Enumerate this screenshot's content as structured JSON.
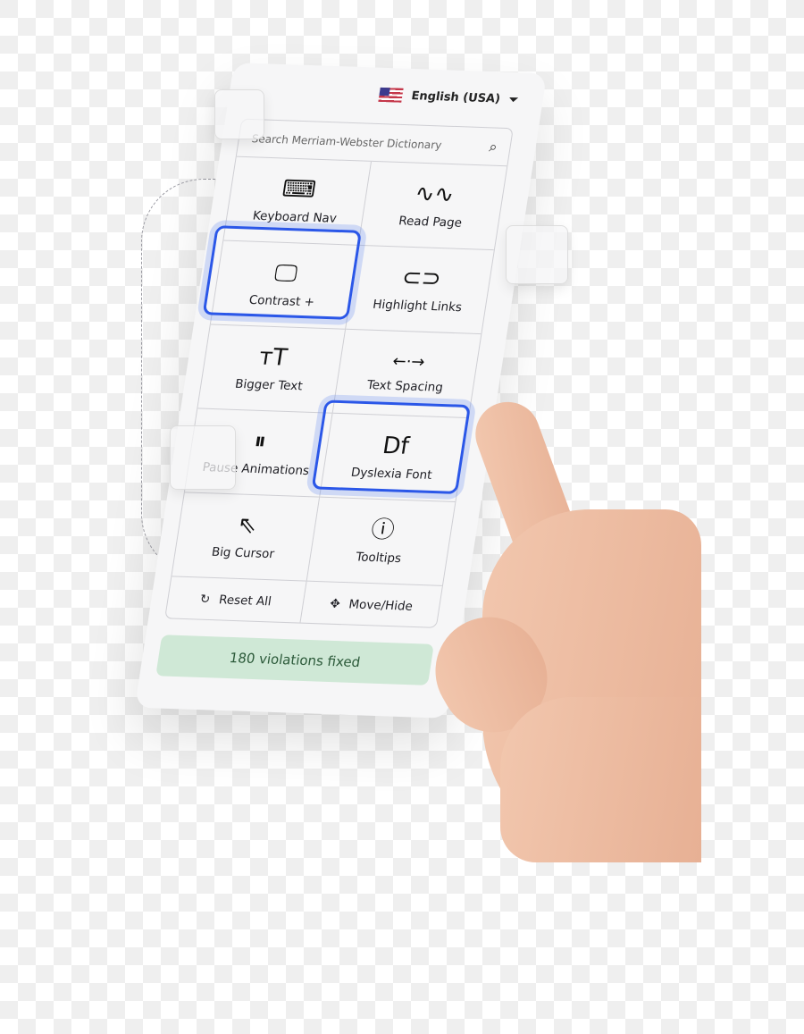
{
  "language": {
    "label": "English (USA)",
    "flag": "us-flag-icon"
  },
  "search": {
    "placeholder": "Search Merriam-Webster Dictionary",
    "icon": "search-icon"
  },
  "tools": [
    {
      "label": "Keyboard Nav",
      "icon": "⌨"
    },
    {
      "label": "Read Page",
      "icon": "∿∿"
    },
    {
      "label": "Contrast +",
      "icon": "🖵"
    },
    {
      "label": "Highlight Links",
      "icon": "⊂⊃"
    },
    {
      "label": "Bigger Text",
      "icon": "тT"
    },
    {
      "label": "Text Spacing",
      "icon": "←·→"
    },
    {
      "label": "Pause Animations",
      "icon": "⏸"
    },
    {
      "label": "Dyslexia Font",
      "icon": "Df"
    },
    {
      "label": "Big Cursor",
      "icon": "⇖"
    },
    {
      "label": "Tooltips",
      "icon": "ⓘ"
    }
  ],
  "footer": {
    "reset": "Reset All",
    "reset_icon": "↻",
    "move": "Move/Hide",
    "move_icon": "✥"
  },
  "status": "180 violations fixed",
  "colors": {
    "highlight": "#2b57e8",
    "status_bg": "#cfe8d6"
  }
}
